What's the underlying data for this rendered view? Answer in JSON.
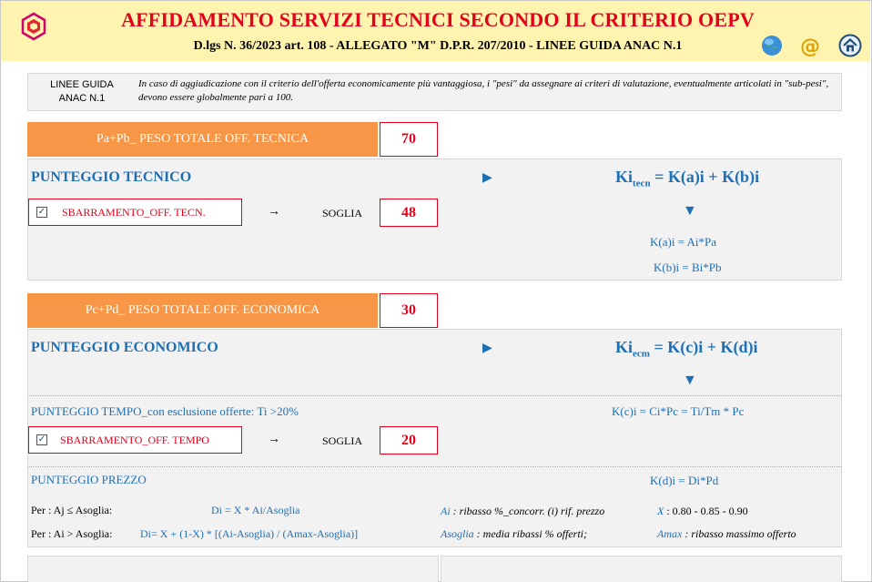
{
  "header": {
    "title": "AFFIDAMENTO SERVIZI TECNICI SECONDO IL CRITERIO OEPV",
    "subtitle": "D.lgs N. 36/2023 art. 108 - ALLEGATO \"M\" D.P.R. 207/2010 - LINEE GUIDA ANAC N.1",
    "icons": [
      "globe-icon",
      "email-icon",
      "home-icon"
    ]
  },
  "note": {
    "label_line1": "LINEE GUIDA",
    "label_line2": "ANAC N.1",
    "text": "In caso di aggiudicazione con il criterio dell'offerta economicamente più vantaggiosa, i \"pesi\" da assegnare ai criteri di valutazione, eventualmente articolati in \"sub-pesi\", devono essere globalmente pari a 100."
  },
  "tecnica": {
    "bar_label": "Pa+Pb_ PESO TOTALE OFF. TECNICA",
    "value": "70",
    "section_title": "PUNTEGGIO TECNICO",
    "formula_main_prefix": "Ki",
    "formula_main_sub": "tecn",
    "formula_main_rest": " = K(a)i + K(b)i",
    "formula_a": "K(a)i = Ai*Pa",
    "formula_b": "K(b)i = Bi*Pb",
    "checkbox_label": "SBARRAMENTO_OFF. TECN.",
    "checkbox_checked": true,
    "soglia_label": "SOGLIA",
    "soglia_value": "48"
  },
  "economica": {
    "bar_label": "Pc+Pd_ PESO TOTALE OFF. ECONOMICA",
    "value": "30",
    "section_title": "PUNTEGGIO ECONOMICO",
    "formula_main_prefix": "Ki",
    "formula_main_sub": "ecm",
    "formula_main_rest": " = K(c)i + K(d)i",
    "tempo_title": "PUNTEGGIO TEMPO_con esclusione offerte: Ti >20%",
    "formula_c": "K(c)i = Ci*Pc = Ti/Tm * Pc",
    "checkbox_label": "SBARRAMENTO_OFF. TEMPO",
    "checkbox_checked": true,
    "soglia_label": "SOGLIA",
    "soglia_value": "20",
    "prezzo_title": "PUNTEGGIO PREZZO",
    "formula_d": "K(d)i = Di*Pd",
    "row1_left": "Per : Aj ≤ Asoglia:",
    "row1_formula": "Di = X * Ai/Asoglia",
    "row1_def_key": "Ai",
    "row1_def_text": " : ribasso %_concorr. (i) rif. prezzo",
    "row1_x_key": "X",
    "row1_x_text": " : 0.80 - 0.85 - 0.90",
    "row2_left": "Per : Ai > Asoglia:",
    "row2_formula": "Di= X + (1-X) * [(Ai-Asoglia) / (Amax-Asoglia)]",
    "row2_def_key": "Asoglia",
    "row2_def_text": " : media ribassi % offerti;",
    "row2_x_key": "Amax",
    "row2_x_text": " : ribasso massimo offerto"
  },
  "colors": {
    "title_red": "#e3001b",
    "header_bg": "#fff3b0",
    "accent_blue": "#1f6fb5",
    "orange": "#f79646"
  }
}
